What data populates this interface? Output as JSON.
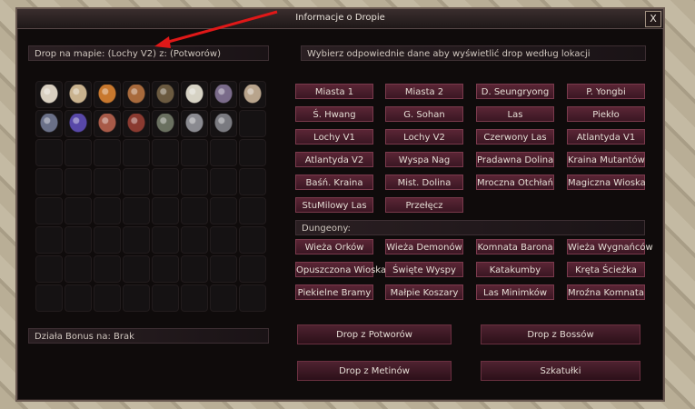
{
  "window": {
    "title": "Informacje o Dropie",
    "close_label": "X"
  },
  "drop_info": "Drop na mapie: (Lochy V2) z: (Potworów)",
  "location_prompt": "Wybierz odpowiednie dane aby wyświetlić drop według lokacji",
  "bonus_info": "Działa Bonus na: Brak",
  "dungeons_label": "Dungeony:",
  "locations": [
    "Miasta 1",
    "Miasta 2",
    "D. Seungryong",
    "P. Yongbi",
    "Ś. Hwang",
    "G. Sohan",
    "Las",
    "Piekło",
    "Lochy V1",
    "Lochy V2",
    "Czerwony Las",
    "Atlantyda V1",
    "Atlantyda V2",
    "Wyspa Nag",
    "Pradawna Dolina",
    "Kraina Mutantów",
    "Baśń. Kraina",
    "Mist. Dolina",
    "Mroczna Otchłań",
    "Magiczna Wioska",
    "StuMilowy Las",
    "Przełęcz"
  ],
  "dungeons": [
    "Wieża Orków",
    "Wieża Demonów",
    "Komnata Barona",
    "Wieża Wygnańców",
    "Opuszczona Wioska",
    "Święte Wyspy",
    "Katakumby",
    "Kręta Ścieżka",
    "Piekielne Bramy",
    "Małpie Koszary",
    "Las Minimków",
    "Mroźna Komnata"
  ],
  "actions": {
    "drop_monsters": "Drop z Potworów",
    "drop_bosses": "Drop z Bossów",
    "drop_metins": "Drop z Metinów",
    "caskets": "Szkatułki"
  },
  "items": [
    {
      "icon": "mushroom-white-icon",
      "color": "#d8cfc0"
    },
    {
      "icon": "mushroom-beige-icon",
      "color": "#c9b28e"
    },
    {
      "icon": "mushroom-orange-icon",
      "color": "#c8782e"
    },
    {
      "icon": "mushroom-brown-icon",
      "color": "#a86a3c"
    },
    {
      "icon": "mushroom-dark-icon",
      "color": "#6b5a40"
    },
    {
      "icon": "mushroom-pale-icon",
      "color": "#d6d2c4"
    },
    {
      "icon": "mask-icon",
      "color": "#7a6b8a"
    },
    {
      "icon": "necklace-icon",
      "color": "#b8a48c"
    },
    {
      "icon": "boot-icon",
      "color": "#6a7088"
    },
    {
      "icon": "earring-icon",
      "color": "#5848a8"
    },
    {
      "icon": "shield-icon",
      "color": "#a85a48"
    },
    {
      "icon": "armor-icon",
      "color": "#8a3a30"
    },
    {
      "icon": "helmet-icon",
      "color": "#6a7060"
    },
    {
      "icon": "bracelet-icon",
      "color": "#8a8a90"
    },
    {
      "icon": "amulet-icon",
      "color": "#7a7a80"
    }
  ],
  "annotation_color": "#e01818"
}
